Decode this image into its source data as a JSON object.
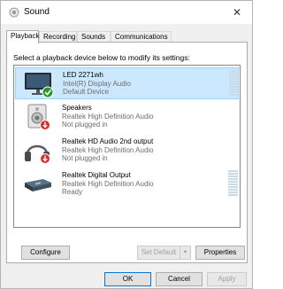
{
  "window": {
    "title": "Sound",
    "close_glyph": "✕"
  },
  "tabs": [
    {
      "label": "Playback",
      "active": true
    },
    {
      "label": "Recording",
      "active": false
    },
    {
      "label": "Sounds",
      "active": false
    },
    {
      "label": "Communications",
      "active": false
    }
  ],
  "instruction": "Select a playback device below to modify its settings:",
  "devices": [
    {
      "name": "LED 2271wh",
      "line1": "Intel(R) Display Audio",
      "line2": "Default Device",
      "icon": "monitor-icon",
      "status": "default-check",
      "selected": true,
      "level_meter": true
    },
    {
      "name": "Speakers",
      "line1": "Realtek High Definition Audio",
      "line2": "Not plugged in",
      "icon": "speaker-icon",
      "status": "unplugged",
      "selected": false,
      "level_meter": false
    },
    {
      "name": "Realtek HD Audio 2nd output",
      "line1": "Realtek High Definition Audio",
      "line2": "Not plugged in",
      "icon": "headphones-icon",
      "status": "unplugged",
      "selected": false,
      "level_meter": false
    },
    {
      "name": "Realtek Digital Output",
      "line1": "Realtek High Definition Audio",
      "line2": "Ready",
      "icon": "digital-output-icon",
      "status": "ready",
      "selected": false,
      "level_meter": true
    }
  ],
  "buttons": {
    "configure": "Configure",
    "set_default": "Set Default",
    "set_default_arrow": "▼",
    "properties": "Properties",
    "ok": "OK",
    "cancel": "Cancel",
    "apply": "Apply"
  },
  "colors": {
    "selection": "#cce8ff",
    "selection_border": "#99d1ff",
    "check_green": "#2a9a2a",
    "unplugged_red": "#d32f2f",
    "focus_blue": "#0078d7"
  }
}
